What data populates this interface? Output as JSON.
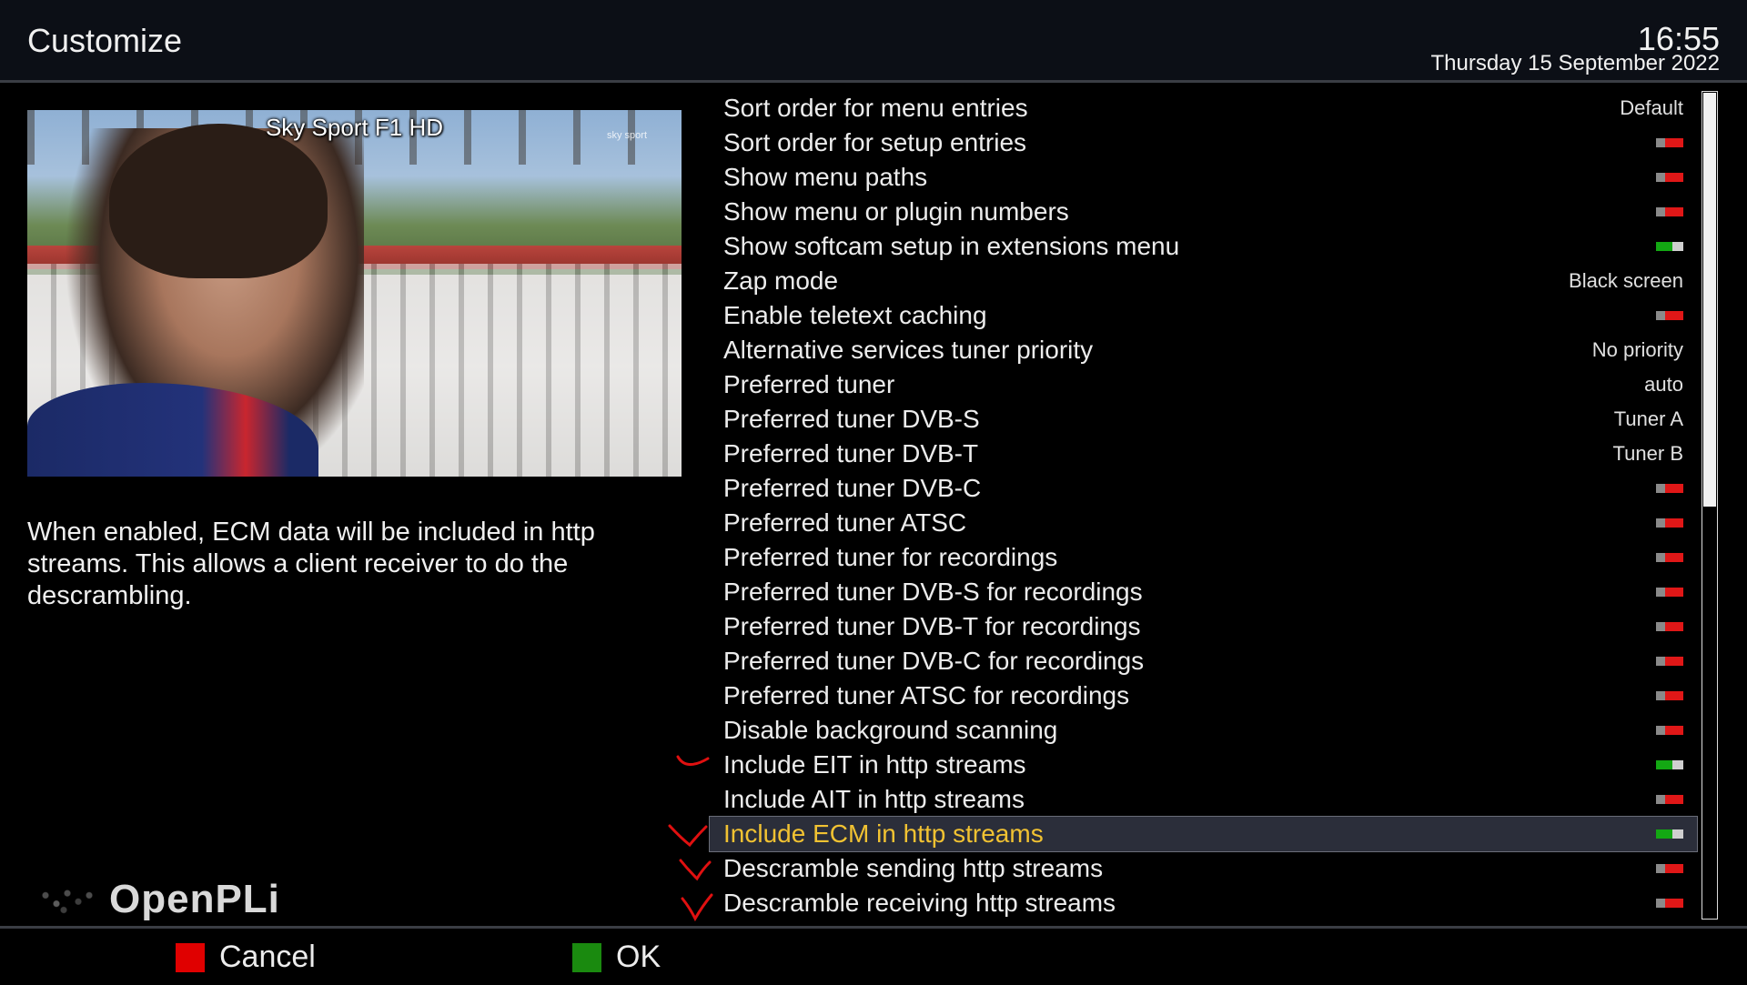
{
  "header": {
    "title": "Customize",
    "time": "16:55",
    "date": "Thursday 15 September 2022"
  },
  "preview": {
    "channel_name": "Sky Sport F1 HD",
    "broadcaster_logo": "sky sport"
  },
  "description": "When enabled, ECM data will be included in http streams. This allows a client receiver to do the descrambling.",
  "brand": {
    "name": "OpenPLi",
    "icon": "world-map-icon"
  },
  "settings": [
    {
      "label": "Sort order for menu entries",
      "type": "text",
      "value": "Default"
    },
    {
      "label": "Sort order for setup entries",
      "type": "toggle",
      "value": "off"
    },
    {
      "label": "Show menu paths",
      "type": "toggle",
      "value": "off"
    },
    {
      "label": "Show menu or plugin numbers",
      "type": "toggle",
      "value": "off"
    },
    {
      "label": "Show softcam setup in extensions menu",
      "type": "toggle",
      "value": "on"
    },
    {
      "label": "Zap mode",
      "type": "text",
      "value": "Black screen"
    },
    {
      "label": "Enable teletext caching",
      "type": "toggle",
      "value": "off"
    },
    {
      "label": "Alternative services tuner priority",
      "type": "text",
      "value": "No priority"
    },
    {
      "label": "Preferred tuner",
      "type": "text",
      "value": "auto"
    },
    {
      "label": "Preferred tuner DVB-S",
      "type": "text",
      "value": "Tuner A"
    },
    {
      "label": "Preferred tuner DVB-T",
      "type": "text",
      "value": "Tuner B"
    },
    {
      "label": "Preferred tuner DVB-C",
      "type": "toggle",
      "value": "off"
    },
    {
      "label": "Preferred tuner ATSC",
      "type": "toggle",
      "value": "off"
    },
    {
      "label": "Preferred tuner for recordings",
      "type": "toggle",
      "value": "off"
    },
    {
      "label": "Preferred tuner DVB-S for recordings",
      "type": "toggle",
      "value": "off"
    },
    {
      "label": "Preferred tuner DVB-T for recordings",
      "type": "toggle",
      "value": "off"
    },
    {
      "label": "Preferred tuner DVB-C for recordings",
      "type": "toggle",
      "value": "off"
    },
    {
      "label": "Preferred tuner ATSC for recordings",
      "type": "toggle",
      "value": "off"
    },
    {
      "label": "Disable background scanning",
      "type": "toggle",
      "value": "off"
    },
    {
      "label": "Include EIT in http streams",
      "type": "toggle",
      "value": "on"
    },
    {
      "label": "Include AIT in http streams",
      "type": "toggle",
      "value": "off"
    },
    {
      "label": "Include ECM in http streams",
      "type": "toggle",
      "value": "on",
      "selected": true
    },
    {
      "label": "Descramble sending http streams",
      "type": "toggle",
      "value": "off"
    },
    {
      "label": "Descramble receiving http streams",
      "type": "toggle",
      "value": "off"
    }
  ],
  "scrollbar": {
    "position": 0.0,
    "visible_fraction": 0.5
  },
  "footer": {
    "buttons": [
      {
        "label": "Cancel",
        "color": "#e00000"
      },
      {
        "label": "OK",
        "color": "#1a8a0f"
      }
    ]
  },
  "colors": {
    "selected_text": "#f1c232",
    "toggle_on": "#13a813",
    "toggle_off": "#e01717",
    "annotation": "#e01010"
  }
}
